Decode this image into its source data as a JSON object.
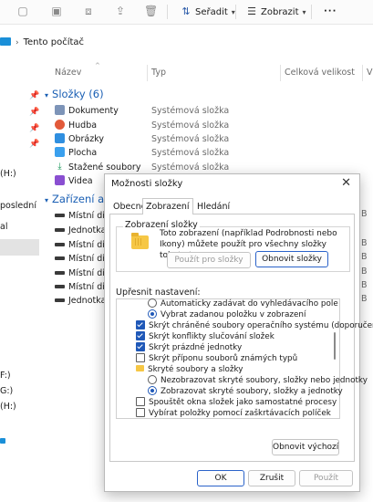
{
  "toolbar": {
    "sort_label": "Seřadit",
    "view_label": "Zobrazit",
    "more_label": "···"
  },
  "address": {
    "location": "Tento počítač"
  },
  "columns": {
    "name": "Název",
    "type": "Typ",
    "total_size": "Celková velikost",
    "free": "V"
  },
  "groups": {
    "folders": "Složky (6)",
    "devices": "Zařízení a j"
  },
  "folders": [
    {
      "name": "Dokumenty",
      "type": "Systémová složka"
    },
    {
      "name": "Hudba",
      "type": "Systémová složka"
    },
    {
      "name": "Obrázky",
      "type": "Systémová složka"
    },
    {
      "name": "Plocha",
      "type": "Systémová složka"
    },
    {
      "name": "Stažené soubory",
      "type": "Systémová složka"
    },
    {
      "name": "Videa",
      "type": "Systémová složka"
    }
  ],
  "devices": [
    {
      "name": "Místní disk",
      "right": "B"
    },
    {
      "name": "Jednotka D",
      "right": ""
    },
    {
      "name": "Místní disk",
      "right": "B"
    },
    {
      "name": "Místní disk",
      "right": "B"
    },
    {
      "name": "Místní disk",
      "right": "B"
    },
    {
      "name": "Místní disk",
      "right": "B"
    },
    {
      "name": "Jednotka U",
      "right": "B"
    }
  ],
  "sidebar": {
    "items": [
      "(H:)",
      "poslední",
      "al",
      "F:)",
      "G:)",
      "(H:)"
    ]
  },
  "dialog": {
    "title": "Možnosti složky",
    "close": "✕",
    "tabs": [
      "Obecné",
      "Zobrazení",
      "Hledání"
    ],
    "folder_view_legend": "Zobrazení složky",
    "folder_view_text": "Toto zobrazení (například Podrobnosti nebo Ikony) můžete použít pro všechny složky tohoto typu.",
    "apply_to_folders": "Použít pro složky",
    "reset_folders": "Obnovit složky",
    "advanced_label": "Upřesnit nastavení:",
    "advanced": [
      {
        "kind": "radio",
        "checked": false,
        "label": "Automaticky zadávat do vyhledávacího pole"
      },
      {
        "kind": "radio",
        "checked": true,
        "label": "Vybrat zadanou položku v zobrazení"
      },
      {
        "kind": "check",
        "checked": true,
        "label": "Skrýt chráněné soubory operačního systému (doporučen"
      },
      {
        "kind": "check",
        "checked": true,
        "label": "Skrýt konflikty slučování složek"
      },
      {
        "kind": "check",
        "checked": true,
        "label": "Skrýt prázdné jednotky"
      },
      {
        "kind": "check",
        "checked": false,
        "label": "Skrýt příponu souborů známých typů"
      },
      {
        "kind": "folder",
        "checked": false,
        "label": "Skryté soubory a složky"
      },
      {
        "kind": "radio",
        "checked": false,
        "label": "Nezobrazovat skryté soubory, složky nebo jednotky"
      },
      {
        "kind": "radio",
        "checked": true,
        "label": "Zobrazovat skryté soubory, složky a jednotky"
      },
      {
        "kind": "check",
        "checked": false,
        "label": "Spouštět okna složek jako samostatné procesy"
      },
      {
        "kind": "check",
        "checked": false,
        "label": "Vybírat položky pomocí zaškrtávacích políček"
      }
    ],
    "restore_defaults": "Obnovit výchozí",
    "ok": "OK",
    "cancel": "Zrušit",
    "apply": "Použít"
  },
  "colors": {
    "accent": "#1f58b8",
    "group_text": "#1a5fb4",
    "folder": "#f6c745"
  }
}
